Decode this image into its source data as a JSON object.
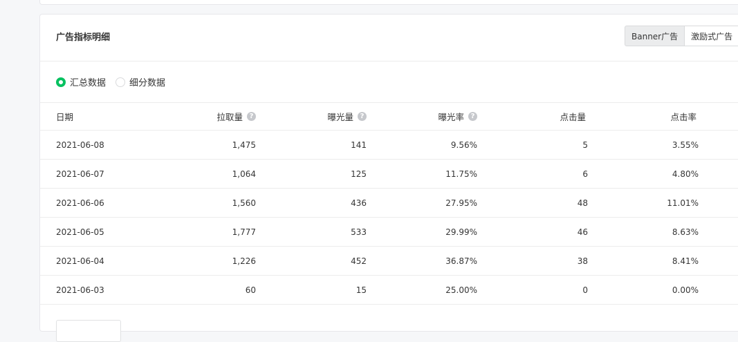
{
  "panel": {
    "title": "广告指标明细",
    "tabs": [
      {
        "label": "Banner广告",
        "active": true
      },
      {
        "label": "激励式广告",
        "active": false
      }
    ],
    "view_options": [
      {
        "label": "汇总数据",
        "checked": true
      },
      {
        "label": "细分数据",
        "checked": false
      }
    ]
  },
  "table": {
    "headers": [
      "日期",
      "拉取量",
      "曝光量",
      "曝光率",
      "点击量",
      "点击率"
    ],
    "help_icon": "?",
    "rows": [
      [
        "2021-06-08",
        "1,475",
        "141",
        "9.56%",
        "5",
        "3.55%"
      ],
      [
        "2021-06-07",
        "1,064",
        "125",
        "11.75%",
        "6",
        "4.80%"
      ],
      [
        "2021-06-06",
        "1,560",
        "436",
        "27.95%",
        "48",
        "11.01%"
      ],
      [
        "2021-06-05",
        "1,777",
        "533",
        "29.99%",
        "46",
        "8.63%"
      ],
      [
        "2021-06-04",
        "1,226",
        "452",
        "36.87%",
        "38",
        "8.41%"
      ],
      [
        "2021-06-03",
        "60",
        "15",
        "25.00%",
        "0",
        "0.00%"
      ]
    ]
  },
  "colors": {
    "accent": "#07c160",
    "border": "#ececec",
    "icon_gray": "#c6c8cc"
  }
}
